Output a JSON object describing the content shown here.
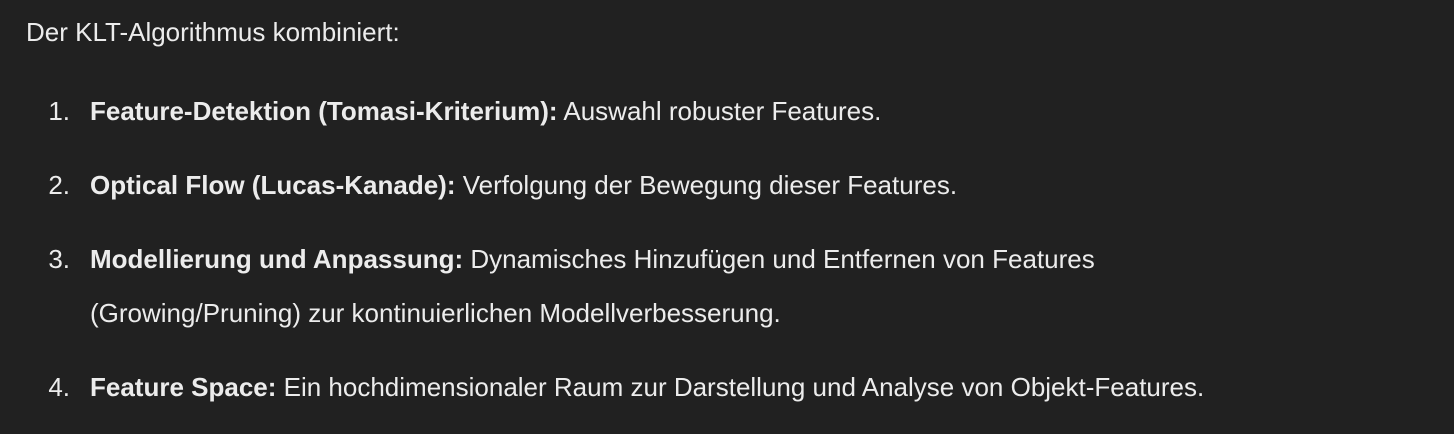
{
  "intro": "Der KLT-Algorithmus kombiniert:",
  "items": [
    {
      "number": "1.",
      "title": "Feature-Detektion (Tomasi-Kriterium):",
      "text": " Auswahl robuster Features."
    },
    {
      "number": "2.",
      "title": "Optical Flow (Lucas-Kanade):",
      "text": " Verfolgung der Bewegung dieser Features."
    },
    {
      "number": "3.",
      "title": "Modellierung und Anpassung:",
      "text": " Dynamisches Hinzufügen und Entfernen von Features (Growing/Pruning) zur kontinuierlichen Modellverbesserung."
    },
    {
      "number": "4.",
      "title": "Feature Space:",
      "text": " Ein hochdimensionaler Raum zur Darstellung und Analyse von Objekt-Features."
    }
  ]
}
